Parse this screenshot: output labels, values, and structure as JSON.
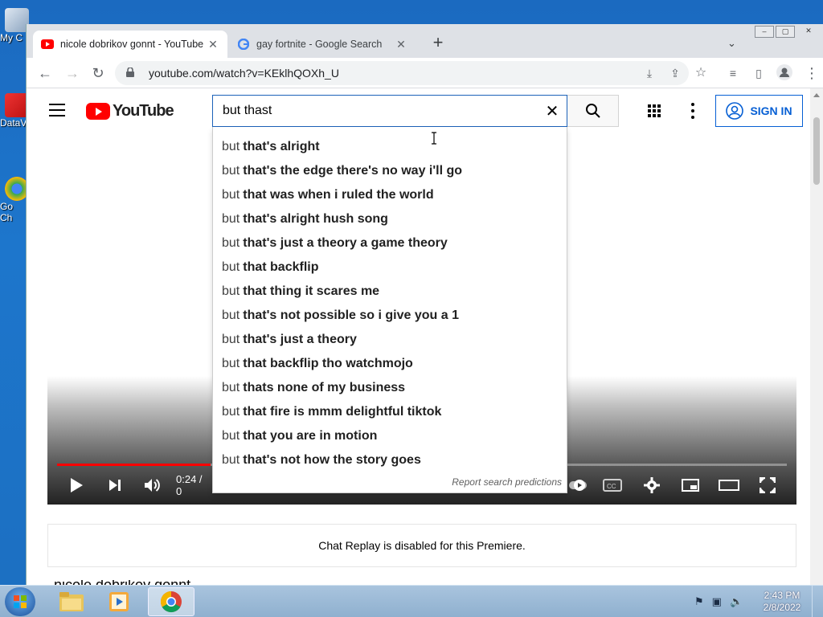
{
  "desktop": {
    "icons": [
      {
        "label": "My C"
      },
      {
        "label": "DataV"
      },
      {
        "label": "Go Ch"
      }
    ]
  },
  "browser": {
    "tabs": [
      {
        "title": "nicole dobrikov gonnt - YouTube",
        "active": true
      },
      {
        "title": "gay fortnite - Google Search",
        "active": false
      }
    ],
    "url": "youtube.com/watch?v=KEklhQOXh_U"
  },
  "youtube": {
    "logo_text": "YouTube",
    "search_value": "but thast",
    "signin_label": "SIGN IN",
    "suggestions": [
      {
        "typed": "but",
        "rest": "that's alright"
      },
      {
        "typed": "but",
        "rest": "that's the edge there's no way i'll go"
      },
      {
        "typed": "but",
        "rest": "that was when i ruled the world"
      },
      {
        "typed": "but",
        "rest": "that's alright hush song"
      },
      {
        "typed": "but",
        "rest": "that's just a theory a game theory"
      },
      {
        "typed": "but",
        "rest": "that backflip"
      },
      {
        "typed": "but",
        "rest": "that thing it scares me"
      },
      {
        "typed": "but",
        "rest": "that's not possible so i give you a 1"
      },
      {
        "typed": "but",
        "rest": "that's just a theory"
      },
      {
        "typed": "but",
        "rest": "that backflip tho watchmojo"
      },
      {
        "typed": "but",
        "rest": "thats none of my business"
      },
      {
        "typed": "but",
        "rest": "that fire is mmm delightful tiktok"
      },
      {
        "typed": "but",
        "rest": "that you are in motion"
      },
      {
        "typed": "but",
        "rest": "that's not how the story goes"
      }
    ],
    "report_label": "Report search predictions",
    "player": {
      "time_text": "0:24 / 0",
      "progress_fraction": 0.21
    },
    "chat_replay_text": "Chat Replay is disabled for this Premiere.",
    "below_text": "nicole dobrikov gonnt"
  },
  "taskbar": {
    "time": "2:43 PM",
    "date": "2/8/2022"
  }
}
